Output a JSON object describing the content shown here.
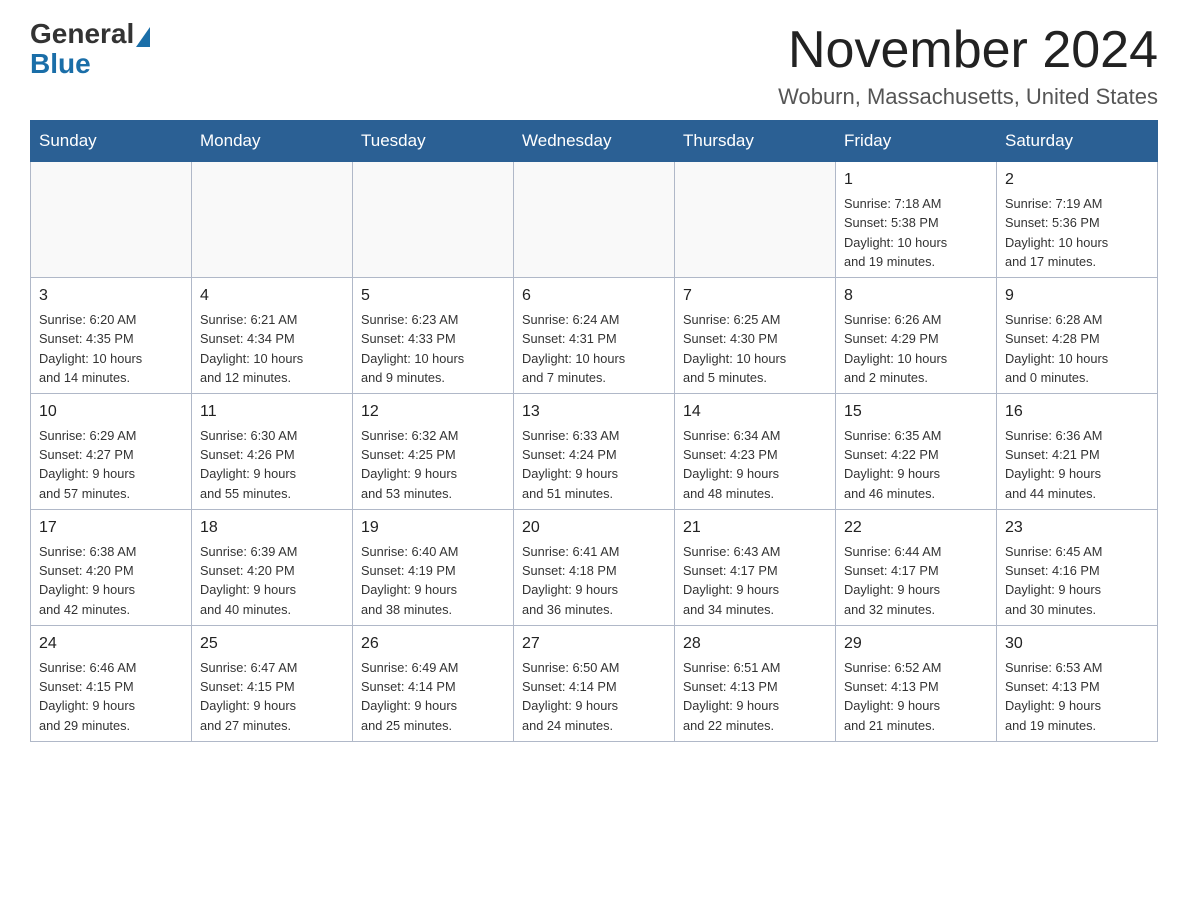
{
  "header": {
    "logo_general": "General",
    "logo_blue": "Blue",
    "month_title": "November 2024",
    "location": "Woburn, Massachusetts, United States"
  },
  "weekdays": [
    "Sunday",
    "Monday",
    "Tuesday",
    "Wednesday",
    "Thursday",
    "Friday",
    "Saturday"
  ],
  "weeks": [
    [
      {
        "day": "",
        "info": ""
      },
      {
        "day": "",
        "info": ""
      },
      {
        "day": "",
        "info": ""
      },
      {
        "day": "",
        "info": ""
      },
      {
        "day": "",
        "info": ""
      },
      {
        "day": "1",
        "info": "Sunrise: 7:18 AM\nSunset: 5:38 PM\nDaylight: 10 hours\nand 19 minutes."
      },
      {
        "day": "2",
        "info": "Sunrise: 7:19 AM\nSunset: 5:36 PM\nDaylight: 10 hours\nand 17 minutes."
      }
    ],
    [
      {
        "day": "3",
        "info": "Sunrise: 6:20 AM\nSunset: 4:35 PM\nDaylight: 10 hours\nand 14 minutes."
      },
      {
        "day": "4",
        "info": "Sunrise: 6:21 AM\nSunset: 4:34 PM\nDaylight: 10 hours\nand 12 minutes."
      },
      {
        "day": "5",
        "info": "Sunrise: 6:23 AM\nSunset: 4:33 PM\nDaylight: 10 hours\nand 9 minutes."
      },
      {
        "day": "6",
        "info": "Sunrise: 6:24 AM\nSunset: 4:31 PM\nDaylight: 10 hours\nand 7 minutes."
      },
      {
        "day": "7",
        "info": "Sunrise: 6:25 AM\nSunset: 4:30 PM\nDaylight: 10 hours\nand 5 minutes."
      },
      {
        "day": "8",
        "info": "Sunrise: 6:26 AM\nSunset: 4:29 PM\nDaylight: 10 hours\nand 2 minutes."
      },
      {
        "day": "9",
        "info": "Sunrise: 6:28 AM\nSunset: 4:28 PM\nDaylight: 10 hours\nand 0 minutes."
      }
    ],
    [
      {
        "day": "10",
        "info": "Sunrise: 6:29 AM\nSunset: 4:27 PM\nDaylight: 9 hours\nand 57 minutes."
      },
      {
        "day": "11",
        "info": "Sunrise: 6:30 AM\nSunset: 4:26 PM\nDaylight: 9 hours\nand 55 minutes."
      },
      {
        "day": "12",
        "info": "Sunrise: 6:32 AM\nSunset: 4:25 PM\nDaylight: 9 hours\nand 53 minutes."
      },
      {
        "day": "13",
        "info": "Sunrise: 6:33 AM\nSunset: 4:24 PM\nDaylight: 9 hours\nand 51 minutes."
      },
      {
        "day": "14",
        "info": "Sunrise: 6:34 AM\nSunset: 4:23 PM\nDaylight: 9 hours\nand 48 minutes."
      },
      {
        "day": "15",
        "info": "Sunrise: 6:35 AM\nSunset: 4:22 PM\nDaylight: 9 hours\nand 46 minutes."
      },
      {
        "day": "16",
        "info": "Sunrise: 6:36 AM\nSunset: 4:21 PM\nDaylight: 9 hours\nand 44 minutes."
      }
    ],
    [
      {
        "day": "17",
        "info": "Sunrise: 6:38 AM\nSunset: 4:20 PM\nDaylight: 9 hours\nand 42 minutes."
      },
      {
        "day": "18",
        "info": "Sunrise: 6:39 AM\nSunset: 4:20 PM\nDaylight: 9 hours\nand 40 minutes."
      },
      {
        "day": "19",
        "info": "Sunrise: 6:40 AM\nSunset: 4:19 PM\nDaylight: 9 hours\nand 38 minutes."
      },
      {
        "day": "20",
        "info": "Sunrise: 6:41 AM\nSunset: 4:18 PM\nDaylight: 9 hours\nand 36 minutes."
      },
      {
        "day": "21",
        "info": "Sunrise: 6:43 AM\nSunset: 4:17 PM\nDaylight: 9 hours\nand 34 minutes."
      },
      {
        "day": "22",
        "info": "Sunrise: 6:44 AM\nSunset: 4:17 PM\nDaylight: 9 hours\nand 32 minutes."
      },
      {
        "day": "23",
        "info": "Sunrise: 6:45 AM\nSunset: 4:16 PM\nDaylight: 9 hours\nand 30 minutes."
      }
    ],
    [
      {
        "day": "24",
        "info": "Sunrise: 6:46 AM\nSunset: 4:15 PM\nDaylight: 9 hours\nand 29 minutes."
      },
      {
        "day": "25",
        "info": "Sunrise: 6:47 AM\nSunset: 4:15 PM\nDaylight: 9 hours\nand 27 minutes."
      },
      {
        "day": "26",
        "info": "Sunrise: 6:49 AM\nSunset: 4:14 PM\nDaylight: 9 hours\nand 25 minutes."
      },
      {
        "day": "27",
        "info": "Sunrise: 6:50 AM\nSunset: 4:14 PM\nDaylight: 9 hours\nand 24 minutes."
      },
      {
        "day": "28",
        "info": "Sunrise: 6:51 AM\nSunset: 4:13 PM\nDaylight: 9 hours\nand 22 minutes."
      },
      {
        "day": "29",
        "info": "Sunrise: 6:52 AM\nSunset: 4:13 PM\nDaylight: 9 hours\nand 21 minutes."
      },
      {
        "day": "30",
        "info": "Sunrise: 6:53 AM\nSunset: 4:13 PM\nDaylight: 9 hours\nand 19 minutes."
      }
    ]
  ]
}
